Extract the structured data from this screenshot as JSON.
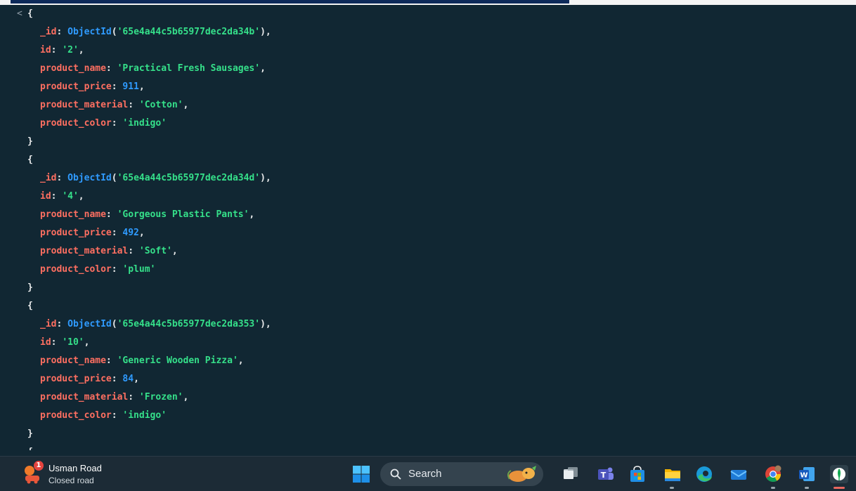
{
  "console": {
    "lines": [
      {
        "type": "open",
        "chevron": "<"
      },
      {
        "type": "oid",
        "key": "_id",
        "fn": "ObjectId",
        "val": "'65e4a44c5b65977dec2da34b'"
      },
      {
        "type": "str",
        "key": "id",
        "val": "'2'"
      },
      {
        "type": "str",
        "key": "product_name",
        "val": "'Practical Fresh Sausages'"
      },
      {
        "type": "num",
        "key": "product_price",
        "val": "911"
      },
      {
        "type": "str",
        "key": "product_material",
        "val": "'Cotton'"
      },
      {
        "type": "strlast",
        "key": "product_color",
        "val": "'indigo'"
      },
      {
        "type": "close"
      },
      {
        "type": "open"
      },
      {
        "type": "oid",
        "key": "_id",
        "fn": "ObjectId",
        "val": "'65e4a44c5b65977dec2da34d'"
      },
      {
        "type": "str",
        "key": "id",
        "val": "'4'"
      },
      {
        "type": "str",
        "key": "product_name",
        "val": "'Gorgeous Plastic Pants'"
      },
      {
        "type": "num",
        "key": "product_price",
        "val": "492"
      },
      {
        "type": "str",
        "key": "product_material",
        "val": "'Soft'"
      },
      {
        "type": "strlast",
        "key": "product_color",
        "val": "'plum'"
      },
      {
        "type": "close"
      },
      {
        "type": "open"
      },
      {
        "type": "oid",
        "key": "_id",
        "fn": "ObjectId",
        "val": "'65e4a44c5b65977dec2da353'"
      },
      {
        "type": "str",
        "key": "id",
        "val": "'10'"
      },
      {
        "type": "str",
        "key": "product_name",
        "val": "'Generic Wooden Pizza'"
      },
      {
        "type": "num",
        "key": "product_price",
        "val": "84"
      },
      {
        "type": "str",
        "key": "product_material",
        "val": "'Frozen'"
      },
      {
        "type": "strlast",
        "key": "product_color",
        "val": "'indigo'"
      },
      {
        "type": "close"
      }
    ]
  },
  "taskbar": {
    "weather": {
      "badge": "1",
      "title": "Usman Road",
      "subtitle": "Closed road",
      "icon": "traffic-alert-icon"
    },
    "search": {
      "label": "Search",
      "icon": "search-icon"
    },
    "apps": [
      {
        "name": "windows-start-icon"
      },
      {
        "name": "task-view-icon"
      },
      {
        "name": "teams-icon"
      },
      {
        "name": "microsoft-store-icon"
      },
      {
        "name": "file-explorer-icon"
      },
      {
        "name": "edge-icon"
      },
      {
        "name": "mail-icon"
      },
      {
        "name": "chrome-icon"
      },
      {
        "name": "word-icon"
      },
      {
        "name": "mongodb-compass-icon"
      }
    ]
  },
  "colors": {
    "background": "#112733",
    "key": "#ff6f61",
    "string": "#35e08a",
    "number": "#2f9bff",
    "taskbar": "#1c2b36"
  }
}
